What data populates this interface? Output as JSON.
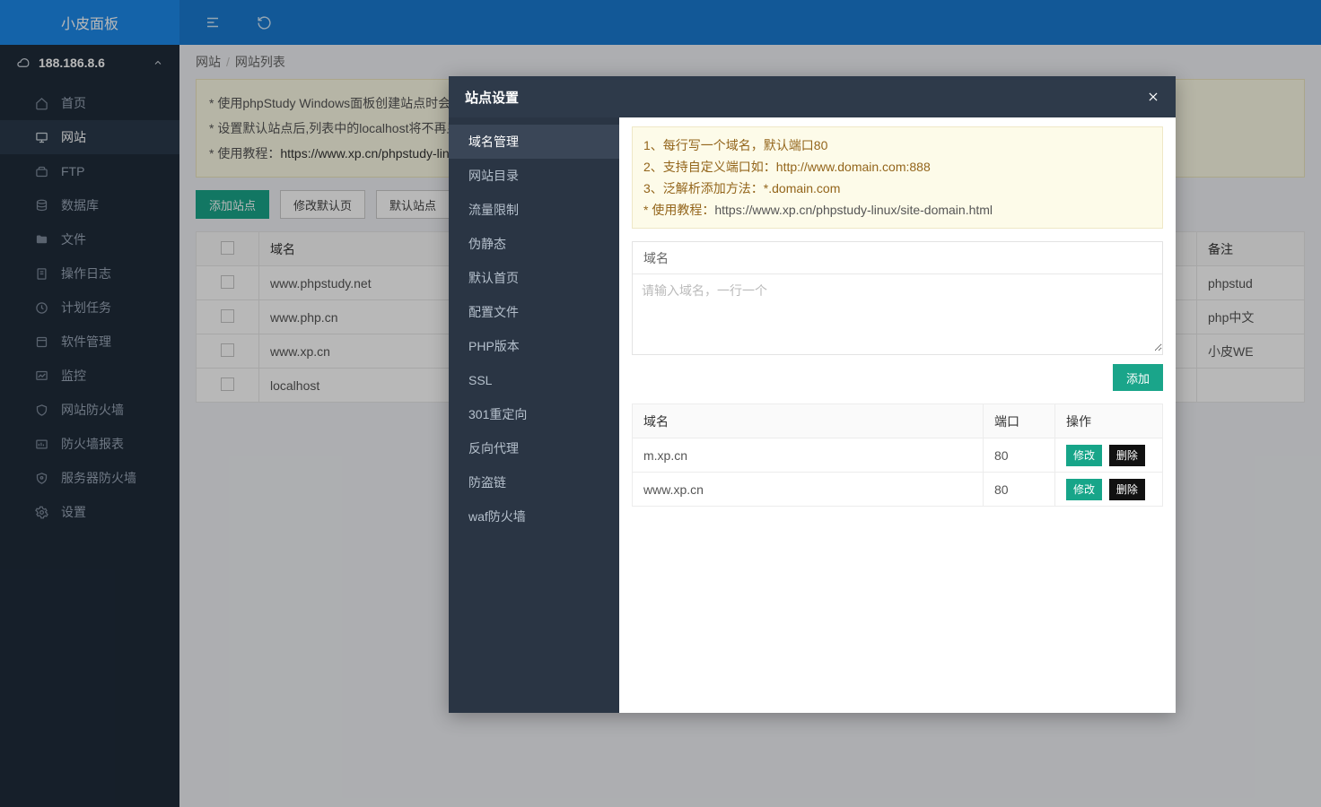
{
  "brand": "小皮面板",
  "ip": "188.186.8.6",
  "sidebar": {
    "items": [
      {
        "label": "首页"
      },
      {
        "label": "网站"
      },
      {
        "label": "FTP"
      },
      {
        "label": "数据库"
      },
      {
        "label": "文件"
      },
      {
        "label": "操作日志"
      },
      {
        "label": "计划任务"
      },
      {
        "label": "软件管理"
      },
      {
        "label": "监控"
      },
      {
        "label": "网站防火墙"
      },
      {
        "label": "防火墙报表"
      },
      {
        "label": "服务器防火墙"
      },
      {
        "label": "设置"
      }
    ]
  },
  "crumb": {
    "a": "网站",
    "b": "网站列表"
  },
  "tips": {
    "l1": "* 使用phpStudy Windows面板创建站点时会",
    "l2": "* 设置默认站点后,列表中的localhost将不再显",
    "l3a": "* 使用教程：",
    "l3b": "https://www.xp.cn/phpstudy-lin"
  },
  "buttons": {
    "add": "添加站点",
    "edit": "修改默认页",
    "def": "默认站点"
  },
  "table": {
    "h_domain": "域名",
    "h_remark": "备注",
    "rows": [
      {
        "domain": "www.phpstudy.net",
        "remark": "phpstud"
      },
      {
        "domain": "www.php.cn",
        "remark": "php中文"
      },
      {
        "domain": "www.xp.cn",
        "remark": "小皮WE"
      },
      {
        "domain": "localhost",
        "remark": ""
      }
    ]
  },
  "modal": {
    "title": "站点设置",
    "side": [
      "域名管理",
      "网站目录",
      "流量限制",
      "伪静态",
      "默认首页",
      "配置文件",
      "PHP版本",
      "SSL",
      "301重定向",
      "反向代理",
      "防盗链",
      "waf防火墙"
    ],
    "hints": {
      "l1": "1、每行写一个域名，默认端口80",
      "l2": "2、支持自定义端口如：http://www.domain.com:888",
      "l3": "3、泛解析添加方法：*.domain.com",
      "l4a": "* 使用教程：",
      "l4b": "https://www.xp.cn/phpstudy-linux/site-domain.html"
    },
    "panel_title": "域名",
    "placeholder": "请输入域名，一行一个",
    "add_label": "添加",
    "dtable": {
      "h_domain": "域名",
      "h_port": "端口",
      "h_ops": "操作",
      "mod": "修改",
      "del": "删除",
      "rows": [
        {
          "domain": "m.xp.cn",
          "port": "80"
        },
        {
          "domain": "www.xp.cn",
          "port": "80"
        }
      ]
    }
  }
}
